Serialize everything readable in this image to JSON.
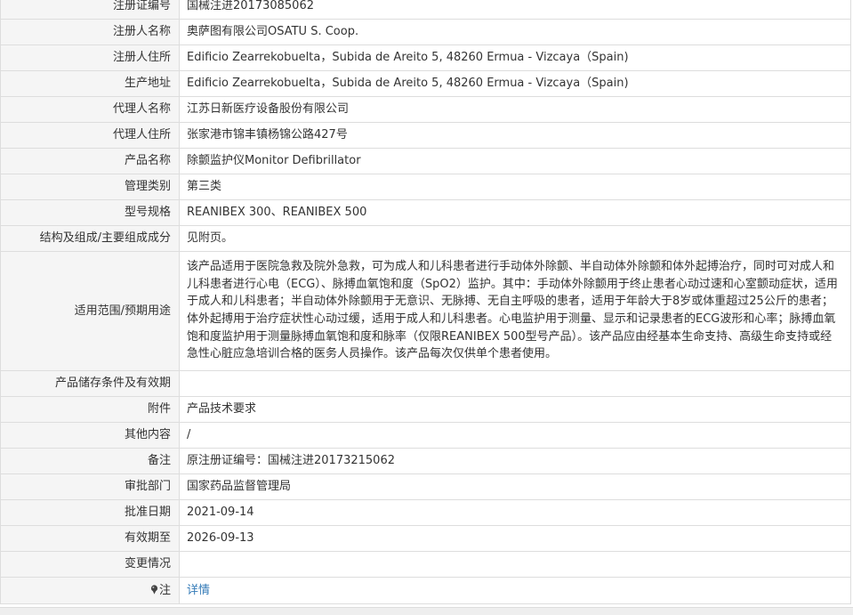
{
  "rows": [
    {
      "label": "注册证编号",
      "value": "国械注进20173085062"
    },
    {
      "label": "注册人名称",
      "value": "奥萨图有限公司OSATU S. Coop."
    },
    {
      "label": "注册人住所",
      "value": "Edificio Zearrekobuelta，Subida de Areito 5, 48260 Ermua - Vizcaya（Spain)"
    },
    {
      "label": "生产地址",
      "value": "Edificio Zearrekobuelta，Subida de Areito 5, 48260 Ermua - Vizcaya（Spain)"
    },
    {
      "label": "代理人名称",
      "value": "江苏日新医疗设备股份有限公司"
    },
    {
      "label": "代理人住所",
      "value": "张家港市锦丰镇杨锦公路427号"
    },
    {
      "label": "产品名称",
      "value": "除颤监护仪Monitor Defibrillator"
    },
    {
      "label": "管理类别",
      "value": "第三类"
    },
    {
      "label": "型号规格",
      "value": "REANIBEX 300、REANIBEX 500"
    },
    {
      "label": "结构及组成/主要组成成分",
      "value": "见附页。"
    },
    {
      "label": "适用范围/预期用途",
      "value": "该产品适用于医院急救及院外急救，可为成人和儿科患者进行手动体外除颤、半自动体外除颤和体外起搏治疗，同时可对成人和儿科患者进行心电（ECG）、脉搏血氧饱和度（SpO2）监护。其中：手动体外除颤用于终止患者心动过速和心室颤动症状，适用于成人和儿科患者；半自动体外除颤用于无意识、无脉搏、无自主呼吸的患者，适用于年龄大于8岁或体重超过25公斤的患者；体外起搏用于治疗症状性心动过缓，适用于成人和儿科患者。心电监护用于测量、显示和记录患者的ECG波形和心率；脉搏血氧饱和度监护用于测量脉搏血氧饱和度和脉率（仅限REANIBEX 500型号产品）。该产品应由经基本生命支持、高级生命支持或经急性心脏应急培训合格的医务人员操作。该产品每次仅供单个患者使用。"
    },
    {
      "label": "产品储存条件及有效期",
      "value": ""
    },
    {
      "label": "附件",
      "value": "产品技术要求"
    },
    {
      "label": "其他内容",
      "value": "/"
    },
    {
      "label": "备注",
      "value": "原注册证编号：国械注进20173215062"
    },
    {
      "label": "审批部门",
      "value": "国家药品监督管理局"
    },
    {
      "label": "批准日期",
      "value": "2021-09-14"
    },
    {
      "label": "有效期至",
      "value": "2026-09-13"
    },
    {
      "label": "变更情况",
      "value": ""
    }
  ],
  "note_row": {
    "label": "注",
    "icon": "pin-icon",
    "link": "详情"
  },
  "colors": {
    "label_bg": "#f5f5f5",
    "border": "#dddddd",
    "link": "#337ab7"
  }
}
